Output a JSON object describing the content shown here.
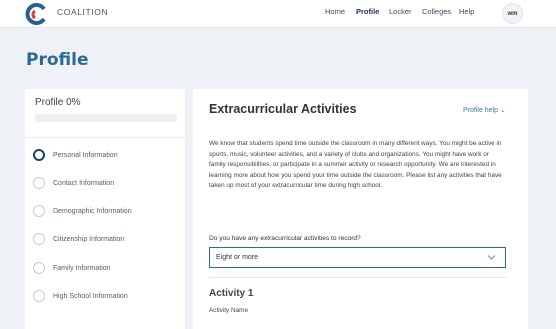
{
  "header": {
    "brand": "COALITION",
    "nav": [
      "Home",
      "Profile",
      "Locker",
      "Colleges",
      "Help"
    ],
    "active_nav": "Profile",
    "avatar_initials": "wm",
    "logo_colors": [
      "#2a5f8f",
      "#d9433b"
    ]
  },
  "page": {
    "title": "Profile"
  },
  "sidebar": {
    "title": "Profile 0%",
    "progress_fraction": 0,
    "items": [
      {
        "label": "Personal Information",
        "active": true
      },
      {
        "label": "Contact Information",
        "active": false
      },
      {
        "label": "Demographic Information",
        "active": false
      },
      {
        "label": "Citizenship Information",
        "active": false
      },
      {
        "label": "Family Information",
        "active": false
      },
      {
        "label": "High School Information",
        "active": false
      }
    ]
  },
  "main": {
    "title": "Extracurricular Activities",
    "help_label": "Profile help",
    "intro": "We know that students spend time outside the classroom in many different ways. You might be active in sports, music, volunteer activities, and a variety of clubs and organizations. You might have work or family responsibilities, or participate in a summer activity or research opportunity. We are interested in learning more about how you spend your time outside the classroom. Please list any activities that have taken up most of your extracurricular time during high school.",
    "question": "Do you have any extracurricular activities to record?",
    "select_value": "Eight or more",
    "activity_title": "Activity 1",
    "activity_name_label": "Activity Name"
  },
  "colors": {
    "accent": "#2a6a95",
    "background": "#eef1f5",
    "link": "#3d78a8"
  }
}
